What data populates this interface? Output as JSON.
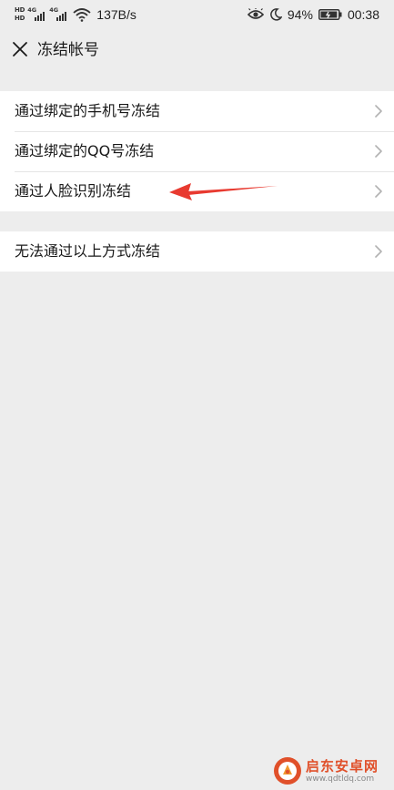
{
  "status_bar": {
    "hd_top": "HD",
    "hd_bottom": "HD",
    "network_1": "4G",
    "network_2": "4G",
    "speed": "137B/s",
    "battery_percent": "94%",
    "battery_level": 0.94,
    "time": "00:38",
    "icons": [
      "hd-icon",
      "signal-icon",
      "wifi-icon",
      "eye-icon",
      "moon-icon",
      "battery-icon"
    ]
  },
  "header": {
    "title": "冻结帐号",
    "close_icon": "close-icon"
  },
  "options": {
    "group_1": [
      {
        "label": "通过绑定的手机号冻结"
      },
      {
        "label": "通过绑定的QQ号冻结"
      },
      {
        "label": "通过人脸识别冻结"
      }
    ],
    "group_2": [
      {
        "label": "无法通过以上方式冻结"
      }
    ],
    "chevron_icon": "chevron-right-icon"
  },
  "annotation": {
    "type": "arrow",
    "color": "#e83a30",
    "points_to": "通过人脸识别冻结"
  },
  "watermark": {
    "name": "启东安卓网",
    "url": "www.qdtldq.com",
    "accent_color": "#e0502a"
  }
}
